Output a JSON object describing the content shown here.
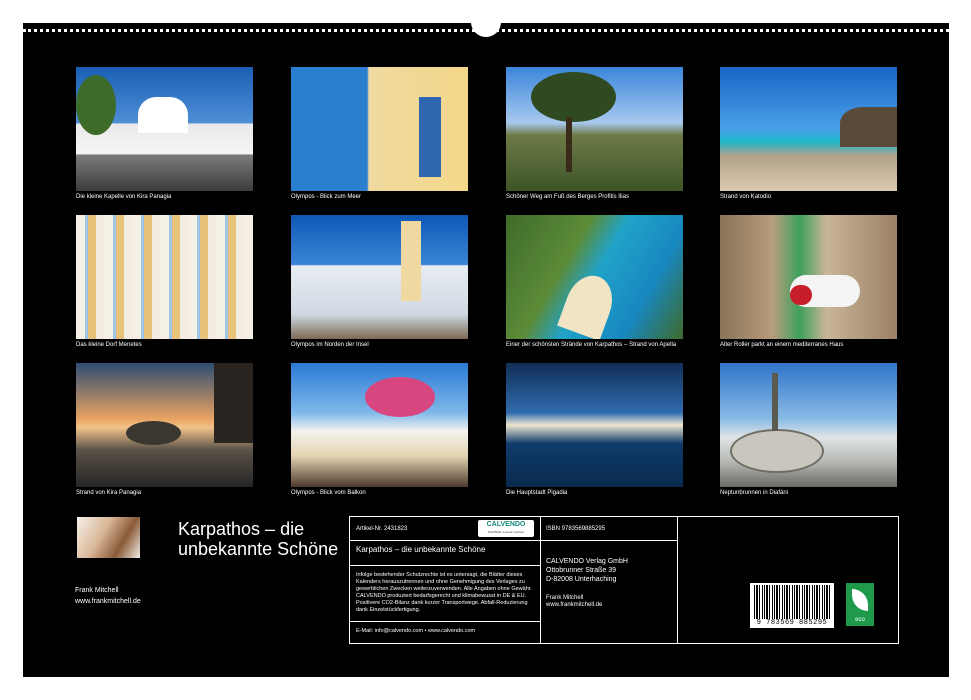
{
  "photos": [
    {
      "caption": "Die kleine Kapelle von Kira Panagia"
    },
    {
      "caption": "Olympos - Blick zum Meer"
    },
    {
      "caption": "Schöner Weg am Fuß des Berges Profitis Ilias"
    },
    {
      "caption": "Strand von Katodio"
    },
    {
      "caption": "Das kleine Dorf Menetes"
    },
    {
      "caption": "Olympos im Norden der Insel"
    },
    {
      "caption": "Einer der schönsten Strände von Karpathos – Strand von Apella"
    },
    {
      "caption": "Alter Roller parkt an einem mediterranes Haus"
    },
    {
      "caption": "Strand von Kira Panagia"
    },
    {
      "caption": "Olympos - Blick vom Balkon"
    },
    {
      "caption": "Die Hauptstadt Pigadia"
    },
    {
      "caption": "Neptunbrunnen in Diafáni"
    }
  ],
  "cover": {
    "title": "Karpathos – die unbekannte Schöne",
    "author": "Frank Mitchell",
    "website": "www.frankmitchell.de"
  },
  "info": {
    "article": "Artikel-Nr. 2431823",
    "logo_text": "CALVENDO",
    "logo_sub": "Weil Bilder Freude machen",
    "calendar_title": "Karpathos – die unbekannte Schöne",
    "legal_1": "Infolge bestehender Schutzrechte ist es untersagt, die Blätter dieses Kalenders herauszutrennen und ohne Genehmigung des Verlages zu gewerblichen Zwecken weiterzuverwenden. Alle Angaben ohne Gewähr.",
    "legal_2": "CALVENDO produziert bedarfsgerecht und klimabewusst in DE & EU. Positivere CO2-Bilanz dank kurzer Transportwege. Abfall-Reduzierung dank Einzelstückfertigung.",
    "contact": "E-Mail: info@calvendo.com • www.calvendo.com",
    "isbn": "ISBN 9783569885295",
    "publisher_name": "CALVENDO Verlag GmbH",
    "publisher_street": "Ottobrunner Straße 39",
    "publisher_city": "D-82008 Unterhaching",
    "photographer": "Frank Mitchell",
    "photographer_web": "www.frankmitchell.de",
    "barcode_number": "9 783569 885295",
    "eco_label": "eco"
  }
}
